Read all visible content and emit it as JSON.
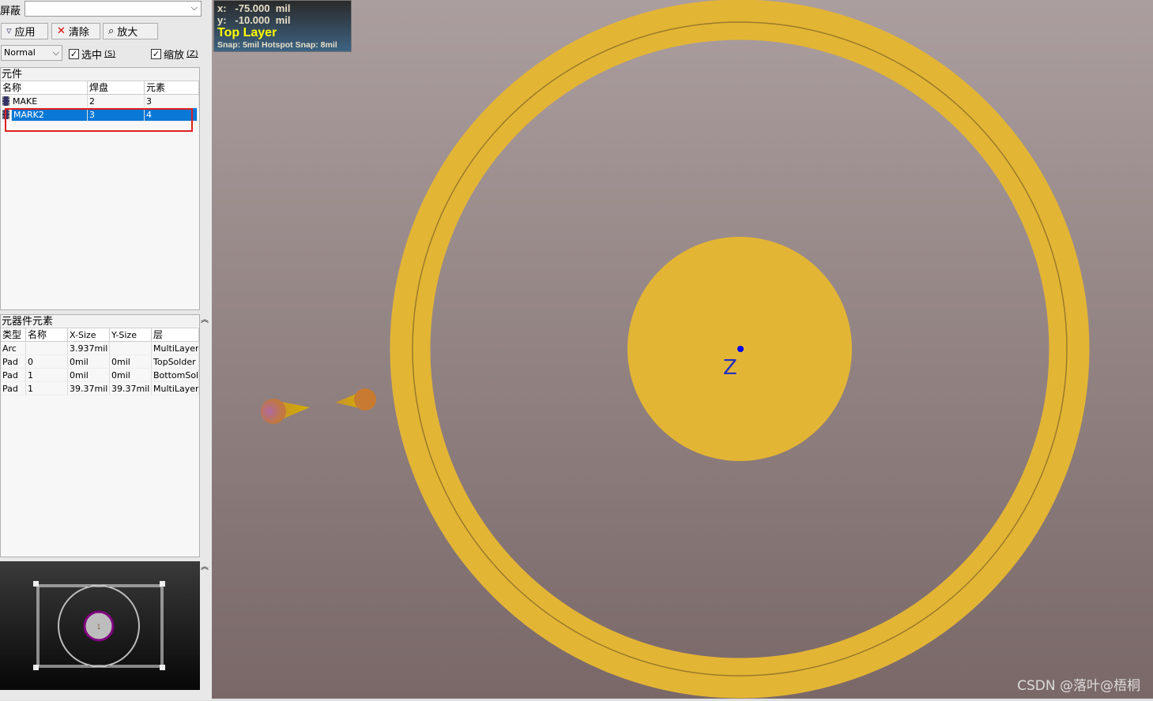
{
  "filter": {
    "label": "屏蔽",
    "value": ""
  },
  "buttons": {
    "apply": "应用",
    "clear": "清除",
    "zoom": "放大"
  },
  "mode": {
    "value": "Normal"
  },
  "checks": {
    "select": "选中",
    "select_key": "(S)",
    "zoom": "缩放",
    "zoom_key": "(Z)",
    "select_checked": true,
    "zoom_checked": true
  },
  "components": {
    "title": "元件",
    "columns": [
      "名称",
      "焊盘",
      "元素"
    ],
    "rows": [
      {
        "name": "MAKE",
        "pads": "2",
        "prims": "3"
      },
      {
        "name": "MARK2",
        "pads": "3",
        "prims": "4",
        "selected": true
      }
    ]
  },
  "primitives": {
    "title": "元器件元素",
    "columns": [
      "类型",
      "名称",
      "X-Size",
      "Y-Size",
      "层"
    ],
    "rows": [
      [
        "Arc",
        "",
        "3.937mil",
        "",
        "MultiLayer"
      ],
      [
        "Pad",
        "0",
        "0mil",
        "0mil",
        "TopSolder"
      ],
      [
        "Pad",
        "1",
        "0mil",
        "0mil",
        "BottomSolc"
      ],
      [
        "Pad",
        "1",
        "39.37mil",
        "39.37mil",
        "MultiLayer"
      ]
    ]
  },
  "preview": {
    "pad_label": "1"
  },
  "info": {
    "x": "x:   -75.000  mil",
    "y": "y:   -10.000  mil",
    "layer": "Top Layer",
    "snap": "Snap: 5mil Hotspot Snap: 8mil"
  },
  "canvas": {
    "designator": "Z"
  },
  "watermark": "CSDN @落叶@梧桐",
  "colors": {
    "pad": "#e3b535",
    "selection": "#0a78d7",
    "layer": "#ffff00"
  }
}
